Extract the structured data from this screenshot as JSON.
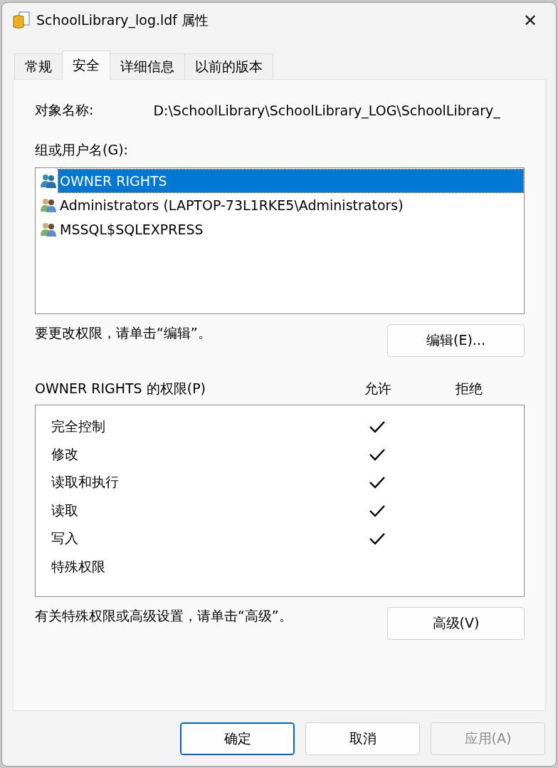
{
  "window": {
    "title": "SchoolLibrary_log.ldf 属性",
    "close": "✕"
  },
  "tabs": [
    {
      "label": "常规",
      "selected": false
    },
    {
      "label": "安全",
      "selected": true
    },
    {
      "label": "详细信息",
      "selected": false
    },
    {
      "label": "以前的版本",
      "selected": false
    }
  ],
  "object_name": {
    "label": "对象名称:",
    "value": "D:\\SchoolLibrary\\SchoolLibrary_LOG\\SchoolLibrary_"
  },
  "groups": {
    "label": "组或用户名(G):",
    "items": [
      {
        "name": "OWNER RIGHTS",
        "selected": true
      },
      {
        "name": "Administrators (LAPTOP-73L1RKE5\\Administrators)",
        "selected": false
      },
      {
        "name": "MSSQL$SQLEXPRESS",
        "selected": false
      }
    ]
  },
  "edit_hint": "要更改权限，请单击“编辑”。",
  "edit_button": "编辑(E)...",
  "permissions": {
    "title": "OWNER RIGHTS 的权限(P)",
    "allow_header": "允许",
    "deny_header": "拒绝",
    "rows": [
      {
        "name": "完全控制",
        "allow": true,
        "deny": false
      },
      {
        "name": "修改",
        "allow": true,
        "deny": false
      },
      {
        "name": "读取和执行",
        "allow": true,
        "deny": false
      },
      {
        "name": "读取",
        "allow": true,
        "deny": false
      },
      {
        "name": "写入",
        "allow": true,
        "deny": false
      },
      {
        "name": "特殊权限",
        "allow": false,
        "deny": false
      }
    ]
  },
  "advanced_hint": "有关特殊权限或高级设置，请单击“高级”。",
  "advanced_button": "高级(V)",
  "buttons": [
    {
      "label": "确定",
      "default": true,
      "disabled": false
    },
    {
      "label": "取消",
      "default": false,
      "disabled": false
    },
    {
      "label": "应用(A)",
      "default": false,
      "disabled": true
    }
  ]
}
